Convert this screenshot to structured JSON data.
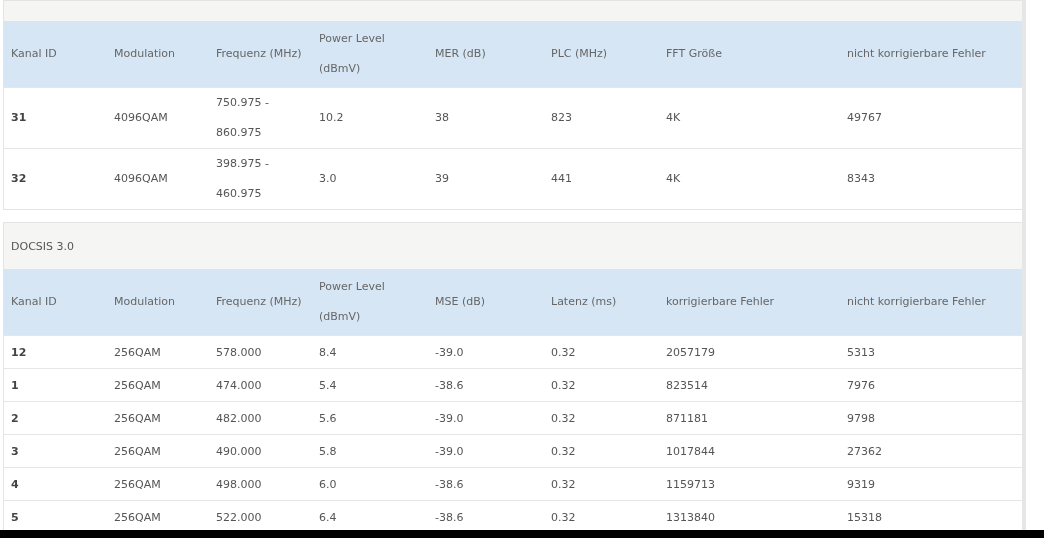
{
  "panels": [
    {
      "columns": [
        "Kanal ID",
        "Modulation",
        "Frequenz (MHz)",
        "Power Level (dBmV)",
        "MER (dB)",
        "PLC (MHz)",
        "FFT Größe",
        "nicht korrigierbare Fehler"
      ],
      "rows": [
        [
          "31",
          "4096QAM",
          "750.975 - 860.975",
          "10.2",
          "38",
          "823",
          "4K",
          "49767"
        ],
        [
          "32",
          "4096QAM",
          "398.975 - 460.975",
          "3.0",
          "39",
          "441",
          "4K",
          "8343"
        ]
      ]
    },
    {
      "title": "DOCSIS 3.0",
      "columns": [
        "Kanal ID",
        "Modulation",
        "Frequenz (MHz)",
        "Power Level (dBmV)",
        "MSE (dB)",
        "Latenz (ms)",
        "korrigierbare Fehler",
        "nicht korrigierbare Fehler"
      ],
      "rows": [
        [
          "12",
          "256QAM",
          "578.000",
          "8.4",
          "-39.0",
          "0.32",
          "2057179",
          "5313"
        ],
        [
          "1",
          "256QAM",
          "474.000",
          "5.4",
          "-38.6",
          "0.32",
          "823514",
          "7976"
        ],
        [
          "2",
          "256QAM",
          "482.000",
          "5.6",
          "-39.0",
          "0.32",
          "871181",
          "9798"
        ],
        [
          "3",
          "256QAM",
          "490.000",
          "5.8",
          "-39.0",
          "0.32",
          "1017844",
          "27362"
        ],
        [
          "4",
          "256QAM",
          "498.000",
          "6.0",
          "-38.6",
          "0.32",
          "1159713",
          "9319"
        ],
        [
          "5",
          "256QAM",
          "522.000",
          "6.4",
          "-38.6",
          "0.32",
          "1313840",
          "15318"
        ]
      ]
    }
  ]
}
